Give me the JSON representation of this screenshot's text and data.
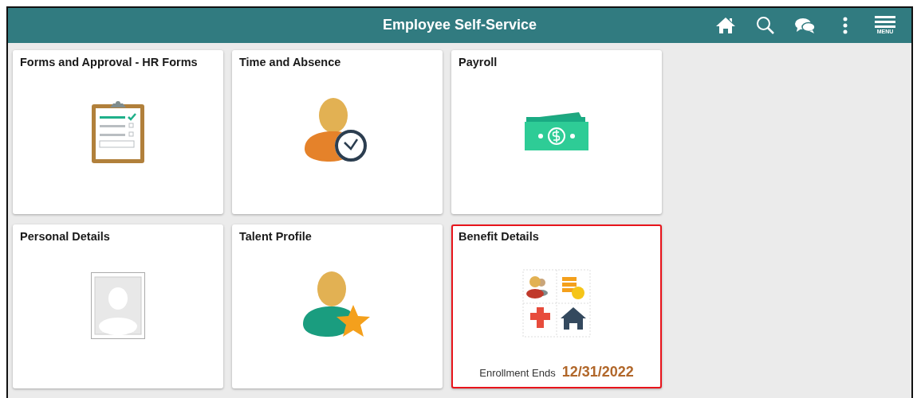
{
  "header": {
    "title": "Employee Self-Service",
    "actions": [
      {
        "kind": "home"
      },
      {
        "kind": "search"
      },
      {
        "kind": "chat"
      },
      {
        "kind": "more"
      },
      {
        "kind": "menu",
        "label": "MENU"
      }
    ]
  },
  "tiles": [
    {
      "title": "Forms and Approval - HR Forms",
      "kind": "clipboard",
      "highlighted": false
    },
    {
      "title": "Time and Absence",
      "kind": "time",
      "highlighted": false
    },
    {
      "title": "Payroll",
      "kind": "payroll",
      "highlighted": false
    },
    {
      "title": "Personal Details",
      "kind": "photo",
      "highlighted": false
    },
    {
      "title": "Talent Profile",
      "kind": "talent",
      "highlighted": false
    },
    {
      "title": "Benefit Details",
      "kind": "benefits",
      "highlighted": true,
      "footer_label": "Enrollment Ends",
      "footer_value": "12/31/2022"
    }
  ]
}
